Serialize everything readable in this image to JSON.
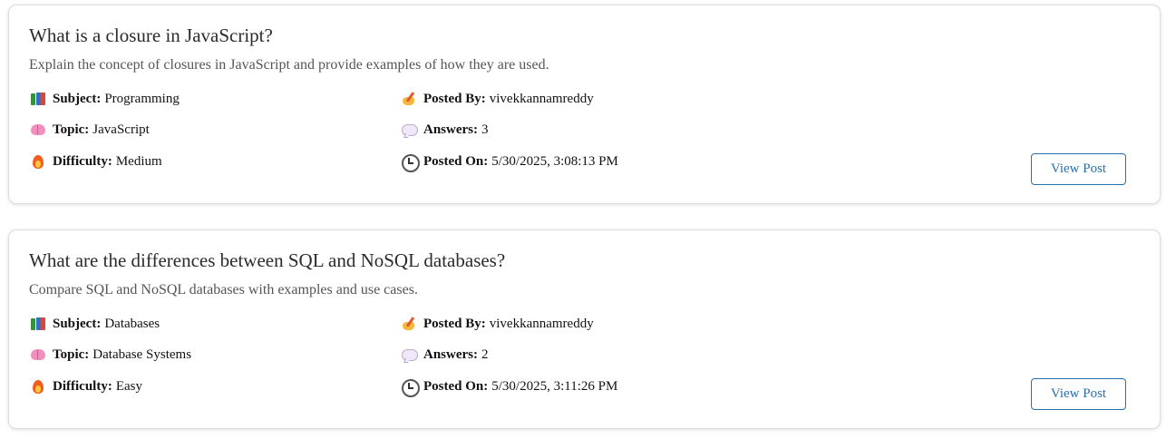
{
  "posts": [
    {
      "title": "What is a closure in JavaScript?",
      "description": "Explain the concept of closures in JavaScript and provide examples of how they are used.",
      "subject_label": "Subject:",
      "subject": "Programming",
      "topic_label": "Topic:",
      "topic": "JavaScript",
      "difficulty_label": "Difficulty:",
      "difficulty": "Medium",
      "posted_by_label": "Posted By:",
      "posted_by": "vivekkannamreddy",
      "answers_label": "Answers:",
      "answers": "3",
      "posted_on_label": "Posted On:",
      "posted_on": "5/30/2025, 3:08:13 PM",
      "button_label": "View Post"
    },
    {
      "title": "What are the differences between SQL and NoSQL databases?",
      "description": "Compare SQL and NoSQL databases with examples and use cases.",
      "subject_label": "Subject:",
      "subject": "Databases",
      "topic_label": "Topic:",
      "topic": "Database Systems",
      "difficulty_label": "Difficulty:",
      "difficulty": "Easy",
      "posted_by_label": "Posted By:",
      "posted_by": "vivekkannamreddy",
      "answers_label": "Answers:",
      "answers": "2",
      "posted_on_label": "Posted On:",
      "posted_on": "5/30/2025, 3:11:26 PM",
      "button_label": "View Post"
    }
  ],
  "icons": {
    "subject": "books-icon",
    "topic": "brain-icon",
    "difficulty": "fire-icon",
    "posted_by": "writing-hand-icon",
    "answers": "speech-bubble-icon",
    "posted_on": "clock-icon"
  },
  "colors": {
    "button_accent": "#2a6fa8",
    "card_border": "#dcdcdc",
    "description_text": "#555555"
  }
}
